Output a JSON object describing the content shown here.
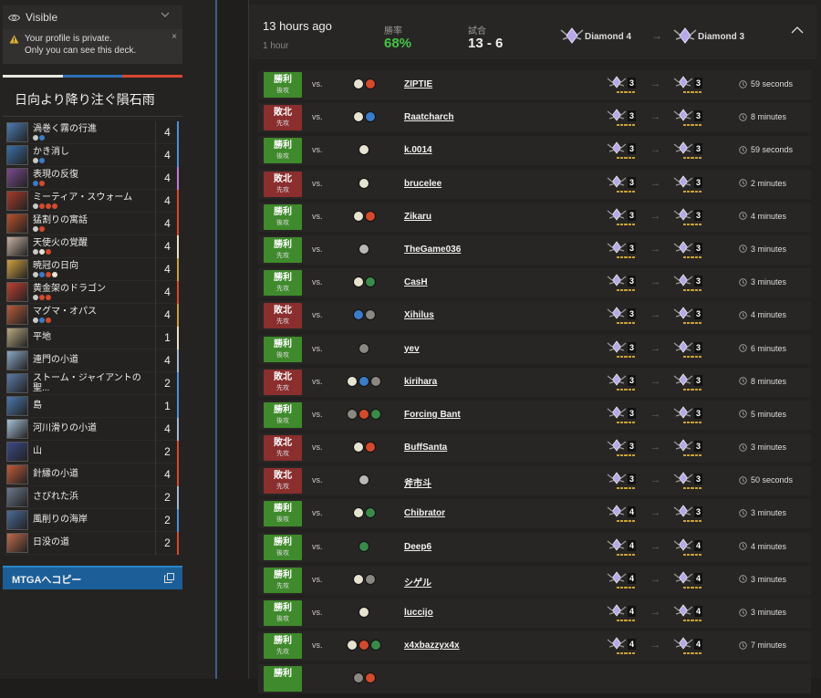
{
  "visibility": {
    "label": "Visible",
    "warning_line1": "Your profile is private.",
    "warning_line2": "Only you can see this deck.",
    "dismiss": "×"
  },
  "deck": {
    "title": "日向より降り注ぐ隕石雨",
    "color_bar": [
      "#e9e6e0",
      "#2d6fb8",
      "#d8482f"
    ],
    "cards": [
      {
        "name": "渦巻く霧の行進",
        "count": "4",
        "colors": [
          "#c9c9c9",
          "#3a7cc8"
        ],
        "art": "#4b7bb3",
        "bar": "#4a8fd8"
      },
      {
        "name": "かき消し",
        "count": "4",
        "colors": [
          "#c9c9c9",
          "#3a7cc8"
        ],
        "art": "#3a6fa8",
        "bar": "#4a8fd8"
      },
      {
        "name": "表現の反復",
        "count": "4",
        "colors": [
          "#3a7cc8",
          "#d44a2c"
        ],
        "art": "#7a4a8e",
        "bar": "#c77ad8"
      },
      {
        "name": "ミーティア・スウォーム",
        "count": "4",
        "colors": [
          "#c9c9c9",
          "#d44a2c",
          "#d44a2c",
          "#d44a2c"
        ],
        "art": "#a83a2a",
        "bar": "#d8482f"
      },
      {
        "name": "猛割りの寓話",
        "count": "4",
        "colors": [
          "#c9c9c9",
          "#d44a2c"
        ],
        "art": "#b8502a",
        "bar": "#d8482f"
      },
      {
        "name": "天使火の覚醒",
        "count": "4",
        "colors": [
          "#c9c9c9",
          "#e8e4d2",
          "#d44a2c"
        ],
        "art": "#c8b0a0",
        "bar": "#e9e2c7"
      },
      {
        "name": "暁冠の日向",
        "count": "4",
        "colors": [
          "#c9c9c9",
          "#3a7cc8",
          "#d44a2c",
          "#e8e4d2"
        ],
        "art": "#d0a040",
        "bar": "#c8a040"
      },
      {
        "name": "黄金架のドラゴン",
        "count": "4",
        "colors": [
          "#c9c9c9",
          "#d44a2c",
          "#d44a2c"
        ],
        "art": "#c04030",
        "bar": "#d8482f"
      },
      {
        "name": "マグマ・オパス",
        "count": "4",
        "colors": [
          "#c9c9c9",
          "#3a7cc8",
          "#d44a2c"
        ],
        "art": "#b85a3a",
        "bar": "#c8a040"
      },
      {
        "name": "平地",
        "count": "1",
        "colors": [],
        "art": "#b8a880",
        "bar": "#e9e2c7"
      },
      {
        "name": "連門の小道",
        "count": "4",
        "colors": [],
        "art": "#8aa8c8",
        "bar": "#a0b8d0"
      },
      {
        "name": "ストーム・ジャイアントの聖...",
        "count": "2",
        "colors": [],
        "art": "#5a7aa8",
        "bar": "#4a8fd8"
      },
      {
        "name": "島",
        "count": "1",
        "colors": [],
        "art": "#4a78b0",
        "bar": "#4a8fd8"
      },
      {
        "name": "河川滑りの小道",
        "count": "4",
        "colors": [],
        "art": "#a8c0d8",
        "bar": "#a0b8d0"
      },
      {
        "name": "山",
        "count": "2",
        "colors": [],
        "art": "#3a4a88",
        "bar": "#d8482f"
      },
      {
        "name": "針縁の小道",
        "count": "4",
        "colors": [],
        "art": "#c05a3a",
        "bar": "#d8482f"
      },
      {
        "name": "さびれた浜",
        "count": "2",
        "colors": [],
        "art": "#6a7888",
        "bar": "#a0b8d0"
      },
      {
        "name": "風削りの海岸",
        "count": "2",
        "colors": [],
        "art": "#4a6a98",
        "bar": "#4a8fd8"
      },
      {
        "name": "日没の道",
        "count": "2",
        "colors": [],
        "art": "#c06a4a",
        "bar": "#d8482f"
      }
    ]
  },
  "copy_button": {
    "label": "MTGAへコピー"
  },
  "summary": {
    "time": "13 hours ago",
    "duration": "1 hour",
    "winrate_label": "勝率",
    "winrate": "68%",
    "matches_label": "試合",
    "record": "13 - 6",
    "rank_from": "Diamond 4",
    "rank_to": "Diamond 3",
    "arrow": "→"
  },
  "matches": [
    {
      "result": "勝利",
      "order": "後攻",
      "win": true,
      "vs": "vs.",
      "opponent": "ZIPTIE",
      "colors": [
        "#e6e3d0",
        "#d44a2c"
      ],
      "rank_before": "3",
      "rank_after": "3",
      "time": "59 seconds"
    },
    {
      "result": "敗北",
      "order": "先攻",
      "win": false,
      "vs": "vs.",
      "opponent": "Raatcharch",
      "colors": [
        "#e6e3d0",
        "#3a7cc8"
      ],
      "rank_before": "3",
      "rank_after": "3",
      "time": "8 minutes"
    },
    {
      "result": "勝利",
      "order": "後攻",
      "win": true,
      "vs": "vs.",
      "opponent": "k.0014",
      "colors": [
        "#e6e3d0"
      ],
      "rank_before": "3",
      "rank_after": "3",
      "time": "59 seconds"
    },
    {
      "result": "敗北",
      "order": "先攻",
      "win": false,
      "vs": "vs.",
      "opponent": "brucelee",
      "colors": [
        "#e6e3d0"
      ],
      "rank_before": "3",
      "rank_after": "3",
      "time": "2 minutes"
    },
    {
      "result": "勝利",
      "order": "後攻",
      "win": true,
      "vs": "vs.",
      "opponent": "Zikaru",
      "colors": [
        "#e6e3d0",
        "#d44a2c"
      ],
      "rank_before": "3",
      "rank_after": "3",
      "time": "4 minutes"
    },
    {
      "result": "勝利",
      "order": "先攻",
      "win": true,
      "vs": "vs.",
      "opponent": "TheGame036",
      "colors": [
        "#b8b8b8"
      ],
      "rank_before": "3",
      "rank_after": "3",
      "time": "3 minutes"
    },
    {
      "result": "勝利",
      "order": "先攻",
      "win": true,
      "vs": "vs.",
      "opponent": "CasH",
      "colors": [
        "#e6e3d0",
        "#3a8a4a"
      ],
      "rank_before": "3",
      "rank_after": "3",
      "time": "3 minutes"
    },
    {
      "result": "敗北",
      "order": "先攻",
      "win": false,
      "vs": "vs.",
      "opponent": "Xihilus",
      "colors": [
        "#3a7cc8",
        "#8a8880"
      ],
      "rank_before": "3",
      "rank_after": "3",
      "time": "4 minutes"
    },
    {
      "result": "勝利",
      "order": "後攻",
      "win": true,
      "vs": "vs.",
      "opponent": "yev",
      "colors": [
        "#8a8880"
      ],
      "rank_before": "3",
      "rank_after": "3",
      "time": "6 minutes"
    },
    {
      "result": "敗北",
      "order": "先攻",
      "win": false,
      "vs": "vs.",
      "opponent": "kirihara",
      "colors": [
        "#e6e3d0",
        "#3a7cc8",
        "#8a8880"
      ],
      "rank_before": "3",
      "rank_after": "3",
      "time": "8 minutes"
    },
    {
      "result": "勝利",
      "order": "後攻",
      "win": true,
      "vs": "vs.",
      "opponent": "Forcing Bant",
      "colors": [
        "#8a8880",
        "#d44a2c",
        "#3a8a4a"
      ],
      "rank_before": "3",
      "rank_after": "3",
      "time": "5 minutes"
    },
    {
      "result": "敗北",
      "order": "先攻",
      "win": false,
      "vs": "vs.",
      "opponent": "BuffSanta",
      "colors": [
        "#e6e3d0",
        "#d44a2c"
      ],
      "rank_before": "3",
      "rank_after": "3",
      "time": "3 minutes"
    },
    {
      "result": "敗北",
      "order": "先攻",
      "win": false,
      "vs": "vs.",
      "opponent": "斧市斗",
      "colors": [
        "#b8b8b8"
      ],
      "rank_before": "3",
      "rank_after": "3",
      "time": "50 seconds"
    },
    {
      "result": "勝利",
      "order": "後攻",
      "win": true,
      "vs": "vs.",
      "opponent": "Chibrator",
      "colors": [
        "#e6e3d0",
        "#3a8a4a"
      ],
      "rank_before": "4",
      "rank_after": "3",
      "time": "3 minutes"
    },
    {
      "result": "勝利",
      "order": "後攻",
      "win": true,
      "vs": "vs.",
      "opponent": "Deep6",
      "colors": [
        "#3a8a4a"
      ],
      "rank_before": "4",
      "rank_after": "4",
      "time": "4 minutes"
    },
    {
      "result": "勝利",
      "order": "先攻",
      "win": true,
      "vs": "vs.",
      "opponent": "シゲル",
      "colors": [
        "#e6e3d0",
        "#8a8880"
      ],
      "rank_before": "4",
      "rank_after": "4",
      "time": "3 minutes"
    },
    {
      "result": "勝利",
      "order": "後攻",
      "win": true,
      "vs": "vs.",
      "opponent": "luccijo",
      "colors": [
        "#e6e3d0"
      ],
      "rank_before": "4",
      "rank_after": "4",
      "time": "3 minutes"
    },
    {
      "result": "勝利",
      "order": "先攻",
      "win": true,
      "vs": "vs.",
      "opponent": "x4xbazzyx4x",
      "colors": [
        "#e6e3d0",
        "#d44a2c",
        "#3a8a4a"
      ],
      "rank_before": "4",
      "rank_after": "4",
      "time": "7 minutes"
    },
    {
      "result": "勝利",
      "order": "",
      "win": true,
      "vs": "",
      "opponent": "",
      "colors": [
        "#8a8880",
        "#d44a2c"
      ],
      "rank_before": "",
      "rank_after": "",
      "time": ""
    }
  ]
}
